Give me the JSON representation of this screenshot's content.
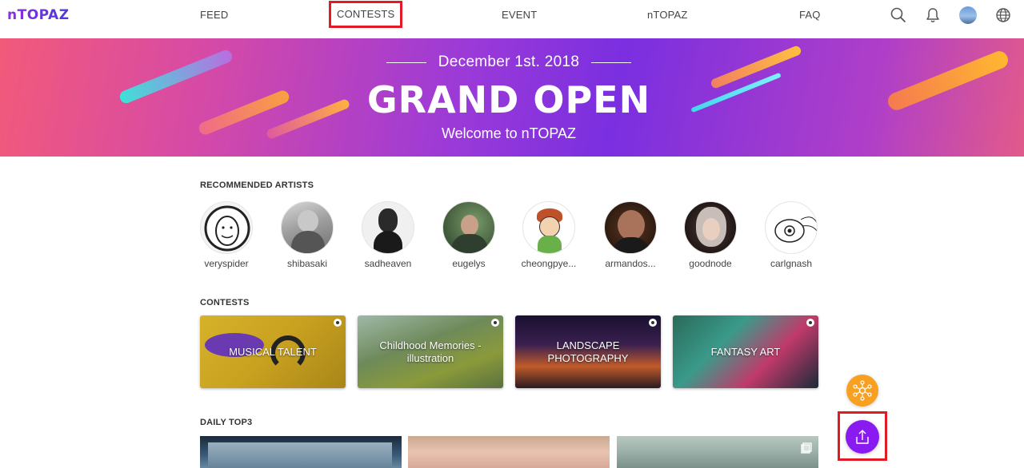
{
  "brand": {
    "logo_text": "nTOPAZ"
  },
  "nav": {
    "items": [
      {
        "label": "FEED"
      },
      {
        "label": "CONTESTS"
      },
      {
        "label": "EVENT"
      },
      {
        "label": "nTOPAZ"
      },
      {
        "label": "FAQ"
      }
    ],
    "icons": [
      "search-icon",
      "bell-icon",
      "avatar",
      "globe-icon"
    ]
  },
  "hero": {
    "date": "December 1st. 2018",
    "title": "GRAND OPEN",
    "subtitle": "Welcome to nTOPAZ"
  },
  "recommended": {
    "title": "RECOMMENDED ARTISTS",
    "artists": [
      {
        "name": "veryspider"
      },
      {
        "name": "shibasaki"
      },
      {
        "name": "sadheaven"
      },
      {
        "name": "eugelys"
      },
      {
        "name": "cheongpye..."
      },
      {
        "name": "armandos..."
      },
      {
        "name": "goodnode"
      },
      {
        "name": "carlgnash"
      }
    ]
  },
  "contests": {
    "title": "CONTESTS",
    "items": [
      {
        "label": "MUSICAL TALENT"
      },
      {
        "label": "Childhood Memories - illustration"
      },
      {
        "label": "LANDSCAPE PHOTOGRAPHY"
      },
      {
        "label": "FANTASY ART"
      }
    ]
  },
  "daily": {
    "title": "DAILY TOP3"
  },
  "colors": {
    "accent": "#8a1bf0",
    "orange": "#f7a021",
    "highlight": "#e01b24"
  }
}
